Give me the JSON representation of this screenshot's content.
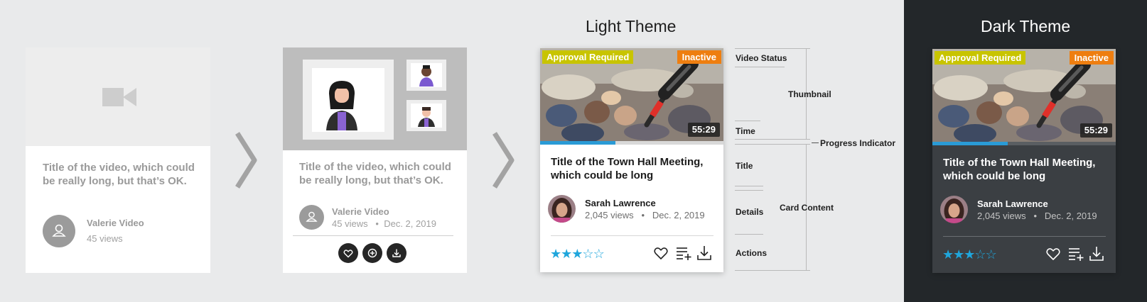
{
  "headings": {
    "light": "Light Theme",
    "dark": "Dark Theme"
  },
  "wireframe_1": {
    "title": "Title of the video, which could be really long, but that’s OK.",
    "author": "Valerie Video",
    "views": "45 views"
  },
  "wireframe_2": {
    "title": "Title of the video, which could be really long, but that’s OK.",
    "author": "Valerie Video",
    "views": "45 views",
    "date": "Dec. 2, 2019"
  },
  "card": {
    "badge_approval": "Approval Required",
    "badge_inactive": "Inactive",
    "duration": "55:29",
    "progress": 0.41,
    "title": "Title of the Town Hall Meeting, which could be long",
    "author": "Sarah Lawrence",
    "views": "2,045 views",
    "date": "Dec. 2, 2019",
    "rating": 3,
    "rating_max": 5,
    "actions": [
      "heart-icon",
      "playlist-add-icon",
      "download-icon"
    ]
  },
  "annotations": {
    "video_status": "Video Status",
    "thumbnail": "Thumbnail",
    "time": "Time",
    "progress_indicator": "Progress Indicator",
    "title": "Title",
    "card_content": "Card Content",
    "details": "Details",
    "actions": "Actions"
  },
  "colors": {
    "approval_badge": "#c8c400",
    "inactive_badge": "#ee7e10",
    "progress": "#2a9bd6",
    "stars": "#1fa6dc",
    "dark_background": "#23272a",
    "dark_card": "#3b3f43"
  }
}
